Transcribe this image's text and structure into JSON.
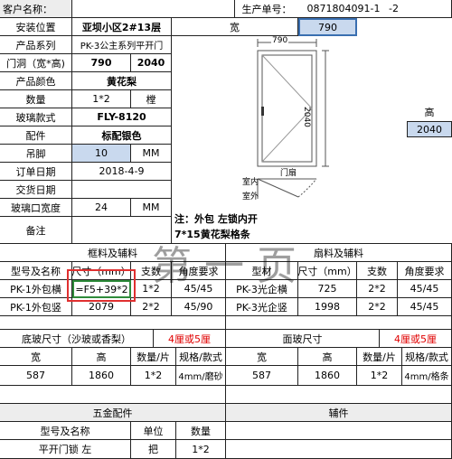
{
  "top": {
    "customer_label": "客户名称：",
    "order_label": "生产单号：",
    "order_value": "0871804091-1",
    "order_suffix": "-2"
  },
  "info": {
    "install_label": "安装位置",
    "install_value": "亚坝小区2#13层",
    "series_label": "产品系列",
    "series_value": "PK-3公主系列平开门",
    "opening_label": "门洞（宽*高)",
    "opening_w": "790",
    "opening_h": "2040",
    "color_label": "产品颜色",
    "color_value": "黄花梨",
    "qty_label": "数量",
    "qty_value": "1*2",
    "qty_unit": "樘",
    "glass_label": "玻璃款式",
    "glass_value": "FLY-8120",
    "parts_label": "配件",
    "parts_value": "标配银色",
    "foot_label": "吊脚",
    "foot_value": "10",
    "foot_unit": "MM",
    "date_label": "订单日期",
    "date_value": "2018-4-9",
    "delivery_label": "交货日期",
    "delivery_value": "",
    "glass_width_label": "玻璃口宽度",
    "glass_width_value": "24",
    "glass_width_unit": "MM",
    "remark_label": "备注"
  },
  "drawing": {
    "width_label": "宽",
    "width_value": "790",
    "height_label": "高",
    "height_value": "2040",
    "dim_top": "790",
    "dim_side": "2040",
    "door_frame_label": "门扇",
    "indoor_label": "室内",
    "outdoor_label": "室外"
  },
  "note": {
    "line1": "注：外包  左锁内开",
    "line2": "7*15黄花梨格条"
  },
  "watermark": "第一页",
  "frame_section": {
    "title": "框料及辅料",
    "headers": [
      "型号及名称",
      "尺寸（mm）",
      "支数",
      "角度要求"
    ],
    "rows": [
      [
        "PK-1外包横",
        "=F5+39*2",
        "1*2",
        "45/45"
      ],
      [
        "PK-1外包竖",
        "2079",
        "2*2",
        "45/90"
      ]
    ]
  },
  "sash_section": {
    "title": "扇料及辅料",
    "headers": [
      "型材",
      "尺寸（mm）",
      "支数",
      "角度要求"
    ],
    "rows": [
      [
        "PK-3光企横",
        "725",
        "2*2",
        "45/45"
      ],
      [
        "PK-3光企竖",
        "1998",
        "2*2",
        "45/45"
      ]
    ]
  },
  "bottom_glass": {
    "title": "底玻尺寸（沙玻或香梨）",
    "thickness": "4厘或5厘",
    "headers": [
      "宽",
      "高",
      "数量/片",
      "规格/款式"
    ],
    "row": [
      "587",
      "1860",
      "1*2",
      "4mm/磨砂"
    ]
  },
  "face_glass": {
    "title": "面玻尺寸",
    "thickness": "4厘或5厘",
    "headers": [
      "宽",
      "高",
      "数量/片",
      "规格/款式"
    ],
    "row": [
      "587",
      "1860",
      "1*2",
      "4mm/格条"
    ]
  },
  "hardware": {
    "title": "五金配件",
    "headers": [
      "型号及名称",
      "单位",
      "数量"
    ],
    "row": [
      "平开门锁 左",
      "把",
      "1*2"
    ]
  },
  "accessories": {
    "title": "辅件"
  },
  "colors": {
    "highlight": "#c9d9ee",
    "red": "#e00000",
    "selection_green": "#2e8b3a",
    "annotation_red": "#e03030"
  }
}
